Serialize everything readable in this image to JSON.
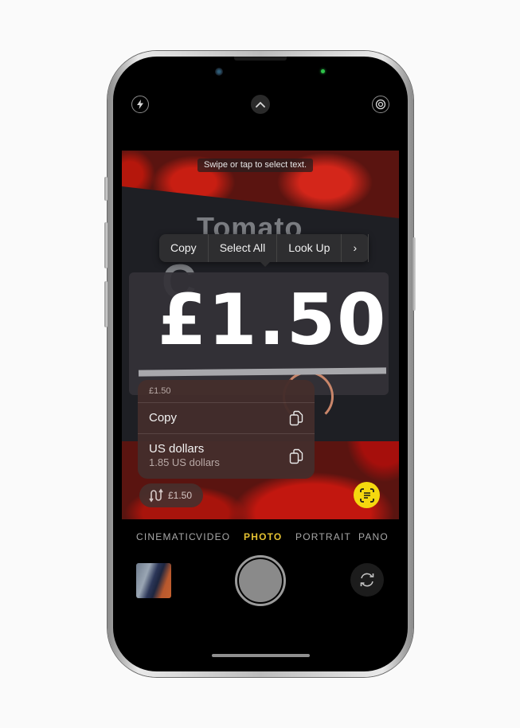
{
  "camera": {
    "top_bar": {
      "flash_icon": "bolt-icon",
      "expand_controls_icon": "chevron-up-icon",
      "live_photo_icon": "concentric-circles-icon"
    },
    "viewfinder": {
      "hint_text": "Swipe or tap to select text.",
      "scene_sign_word": "Tomato",
      "scene_sign_letter": "C",
      "detected_price": "£1.50"
    },
    "edit_menu": {
      "items": [
        {
          "label": "Copy"
        },
        {
          "label": "Select All"
        },
        {
          "label": "Look Up"
        },
        {
          "label": "›"
        }
      ]
    },
    "data_detector_menu": {
      "header": "£1.50",
      "rows": [
        {
          "title": "Copy",
          "icon": "doc-on-doc-icon"
        },
        {
          "title": "US dollars",
          "subtitle": "1.85 US dollars",
          "icon": "doc-on-doc-icon"
        }
      ]
    },
    "convert_pill": {
      "icon": "arrows-convert-icon",
      "label": "£1.50"
    },
    "live_text_button": {
      "icon": "live-text-icon",
      "color": "#f5d80f"
    },
    "modes": {
      "items": [
        "CINEMATIC",
        "VIDEO",
        "PHOTO",
        "PORTRAIT",
        "PANO"
      ],
      "active": "PHOTO",
      "active_color": "#e5c232"
    },
    "bottom_controls": {
      "thumbnail": "last-photo-thumbnail",
      "shutter": "shutter-button",
      "flip_icon": "camera-flip-icon"
    }
  }
}
